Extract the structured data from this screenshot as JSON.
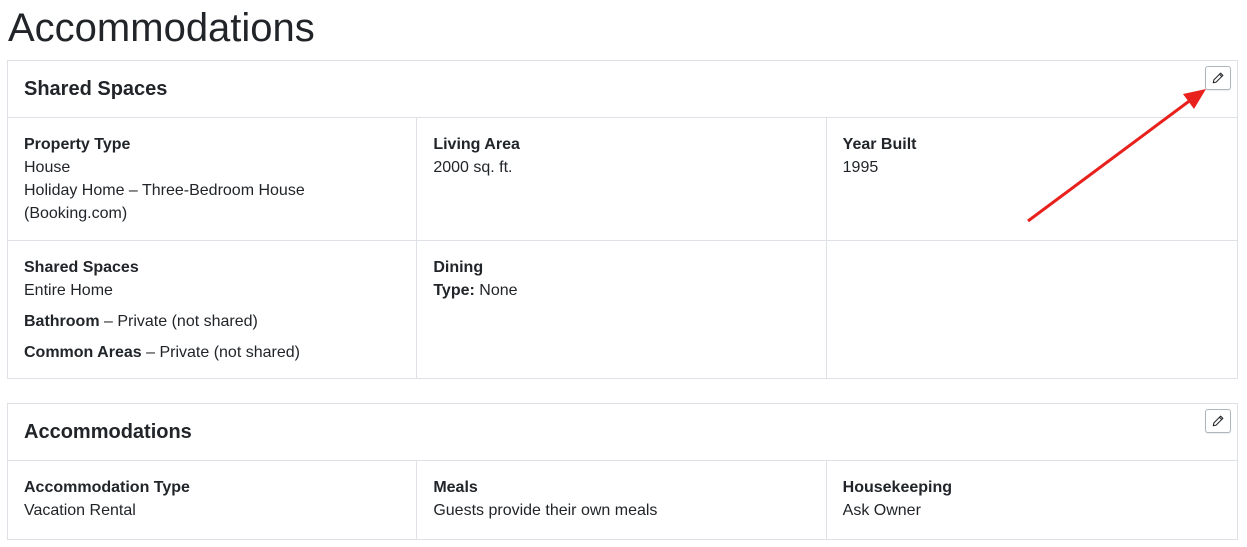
{
  "page": {
    "title": "Accommodations"
  },
  "shared_spaces_panel": {
    "title": "Shared Spaces",
    "edit_icon": "pencil-icon",
    "property_type": {
      "label": "Property Type",
      "value": "House",
      "value2": "Holiday Home – Three-Bedroom House (Booking.com)"
    },
    "living_area": {
      "label": "Living Area",
      "value": "2000 sq. ft."
    },
    "year_built": {
      "label": "Year Built",
      "value": "1995"
    },
    "shared_spaces": {
      "label": "Shared Spaces",
      "value": "Entire Home",
      "bathroom_label": "Bathroom",
      "bathroom_value": " – Private (not shared)",
      "common_label": "Common Areas",
      "common_value": " – Private (not shared)"
    },
    "dining": {
      "label": "Dining",
      "type_label": "Type:",
      "type_value": " None"
    }
  },
  "accommodations_panel": {
    "title": "Accommodations",
    "edit_icon": "pencil-icon",
    "accommodation_type": {
      "label": "Accommodation Type",
      "value": "Vacation Rental"
    },
    "meals": {
      "label": "Meals",
      "value": "Guests provide their own meals"
    },
    "housekeeping": {
      "label": "Housekeeping",
      "value": "Ask Owner"
    }
  },
  "colors": {
    "border": "#dee2e6",
    "text": "#212529",
    "arrow": "#e8211d"
  }
}
